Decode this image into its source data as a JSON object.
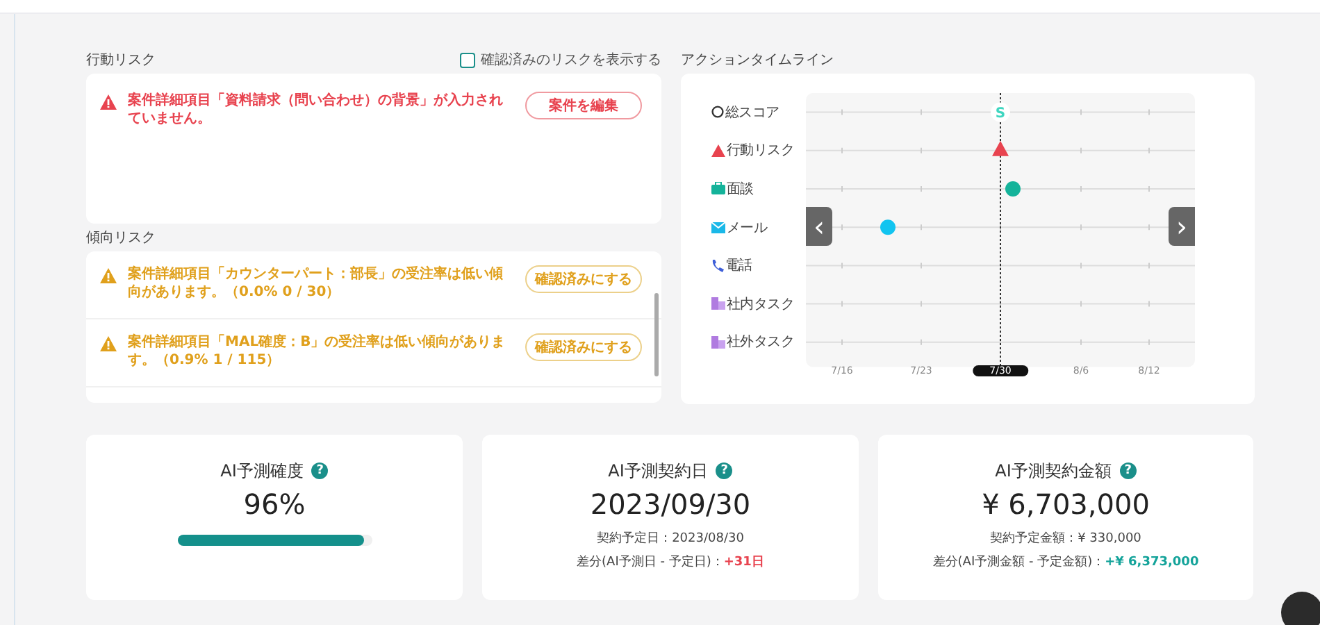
{
  "behavior_risk": {
    "title": "行動リスク",
    "show_confirmed": {
      "label": "確認済みのリスクを表示する",
      "checked": false
    },
    "items": [
      {
        "message": "案件詳細項目「資料請求（問い合わせ）の背景」が入力されていません。",
        "button": "案件を編集"
      }
    ]
  },
  "trend_risk": {
    "title": "傾向リスク",
    "items": [
      {
        "message": "案件詳細項目「カウンターパート：部長」の受注率は低い傾向があります。（0.0% 0 / 30）",
        "button": "確認済みにする"
      },
      {
        "message": "案件詳細項目「MAL確度：B」の受注率は低い傾向があります。（0.9% 1 / 115）",
        "button": "確認済みにする"
      }
    ]
  },
  "timeline": {
    "title": "アクションタイムライン",
    "rows": [
      {
        "label": "総スコア",
        "kind": "score",
        "marker": "S"
      },
      {
        "label": "行動リスク",
        "kind": "risk"
      },
      {
        "label": "面談",
        "kind": "meeting"
      },
      {
        "label": "メール",
        "kind": "mail"
      },
      {
        "label": "電話",
        "kind": "phone"
      },
      {
        "label": "社内タスク",
        "kind": "task"
      },
      {
        "label": "社外タスク",
        "kind": "task"
      }
    ],
    "dates": [
      {
        "label": "7/16",
        "selected": false
      },
      {
        "label": "7/23",
        "selected": false
      },
      {
        "label": "7/30",
        "selected": true
      },
      {
        "label": "8/6",
        "selected": false
      },
      {
        "label": "8/12",
        "selected": false
      }
    ],
    "prev": "‹",
    "next": "›"
  },
  "metrics": [
    {
      "title": "AI予測確度",
      "help": "?",
      "value": "96%",
      "kind": "progress",
      "level": 0.96
    },
    {
      "title": "AI予測契約日",
      "help": "?",
      "value": "2023/09/30",
      "kind": "detail",
      "lines": [
        {
          "label": "契約予定日：2023/08/30"
        },
        {
          "label": "差分(AI予測日 - 予定日)：",
          "diff": "+31日",
          "color": "#e8434f"
        }
      ]
    },
    {
      "title": "AI予測契約金額",
      "help": "?",
      "value": "¥ 6,703,000",
      "kind": "detail",
      "lines": [
        {
          "label": "契約予定金額：¥ 330,000"
        },
        {
          "label": "差分(AI予測金額 - 予定金額)：",
          "diff": "+¥ 6,373,000",
          "color": "#14a39a"
        }
      ]
    }
  ]
}
